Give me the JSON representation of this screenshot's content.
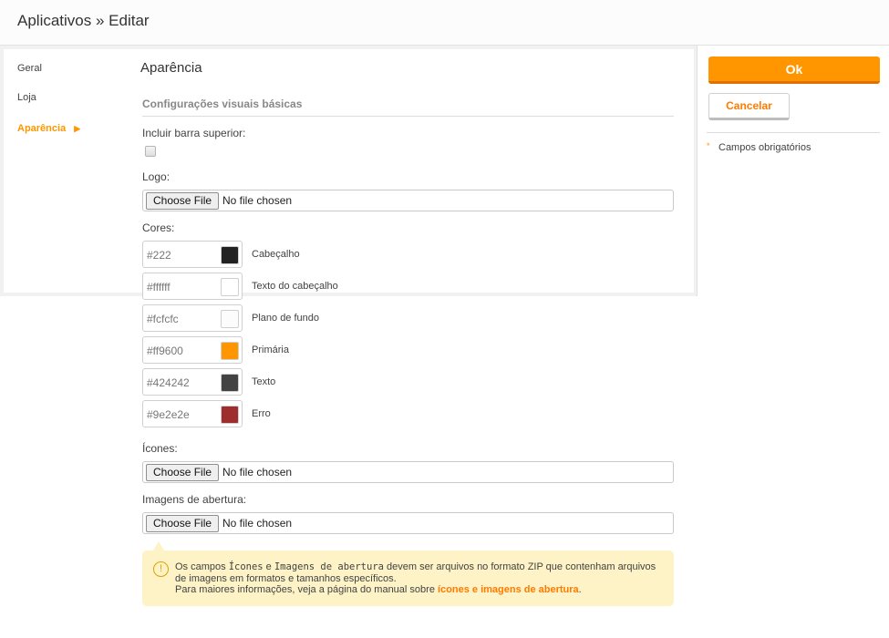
{
  "header": {
    "title": "Aplicativos » Editar"
  },
  "nav": {
    "items": [
      {
        "label": "Geral",
        "active": false
      },
      {
        "label": "Loja",
        "active": false
      },
      {
        "label": "Aparência",
        "active": true
      }
    ],
    "active_arrow": "▶"
  },
  "section": {
    "title": "Aparência",
    "subsection": "Configurações visuais básicas"
  },
  "form": {
    "top_bar_label": "Incluir barra superior:",
    "top_bar_checked": false,
    "logo_label": "Logo:",
    "colors_label": "Cores:",
    "icons_label": "Ícones:",
    "splash_label": "Imagens de abertura:",
    "file_button_label": "Choose File",
    "file_status": "No file chosen",
    "colors": [
      {
        "value": "#222",
        "swatch": "#222222",
        "name": "Cabeçalho"
      },
      {
        "value": "#ffffff",
        "swatch": "#ffffff",
        "name": "Texto do cabeçalho"
      },
      {
        "value": "#fcfcfc",
        "swatch": "#fcfcfc",
        "name": "Plano de fundo"
      },
      {
        "value": "#ff9600",
        "swatch": "#ff9600",
        "name": "Primária"
      },
      {
        "value": "#424242",
        "swatch": "#424242",
        "name": "Texto"
      },
      {
        "value": "#9e2e2e",
        "swatch": "#9e2e2e",
        "name": "Erro"
      }
    ]
  },
  "notice": {
    "icon": "!",
    "text_1": "Os campos ",
    "code_1": "Ícones",
    "text_2": " e ",
    "code_2": "Imagens de abertura",
    "text_3": " devem ser arquivos no formato ZIP que contenham arquivos de imagens em formatos e tamanhos específicos.",
    "text_4": "Para maiores informações, veja a página do manual sobre ",
    "link": "ícones e imagens de abertura",
    "text_5": "."
  },
  "actions": {
    "ok_label": "Ok",
    "cancel_label": "Cancelar",
    "required_mark": "*",
    "required_label": "Campos obrigatórios"
  },
  "theme": {
    "accent": "#ff9600",
    "link": "#ff7b00",
    "notice_bg": "#fdf3c6"
  }
}
